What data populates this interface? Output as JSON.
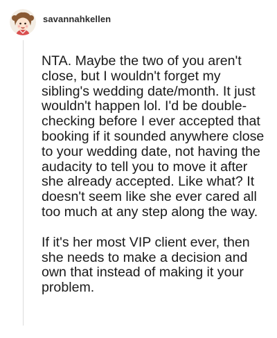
{
  "comment": {
    "username": "savannahkellen",
    "avatar_icon": "cartoon-girl-avatar-icon",
    "paragraphs": [
      "NTA. Maybe the two of you aren't close, but I wouldn't forget my sibling's wedding date/month. It just wouldn't happen lol. I'd be double-checking before I ever accepted that booking if it sounded anywhere close to your wedding date, not having the audacity to tell you to move it after she already accepted. Like what? It doesn't seem like she ever cared all too much at any step along the way.",
      "If it's her most VIP client ever, then she needs to make a decision and own that instead of making it your problem."
    ]
  },
  "colors": {
    "background": "#ffffff",
    "text": "#1a1a1a",
    "thread_line": "#dcdcdc"
  }
}
